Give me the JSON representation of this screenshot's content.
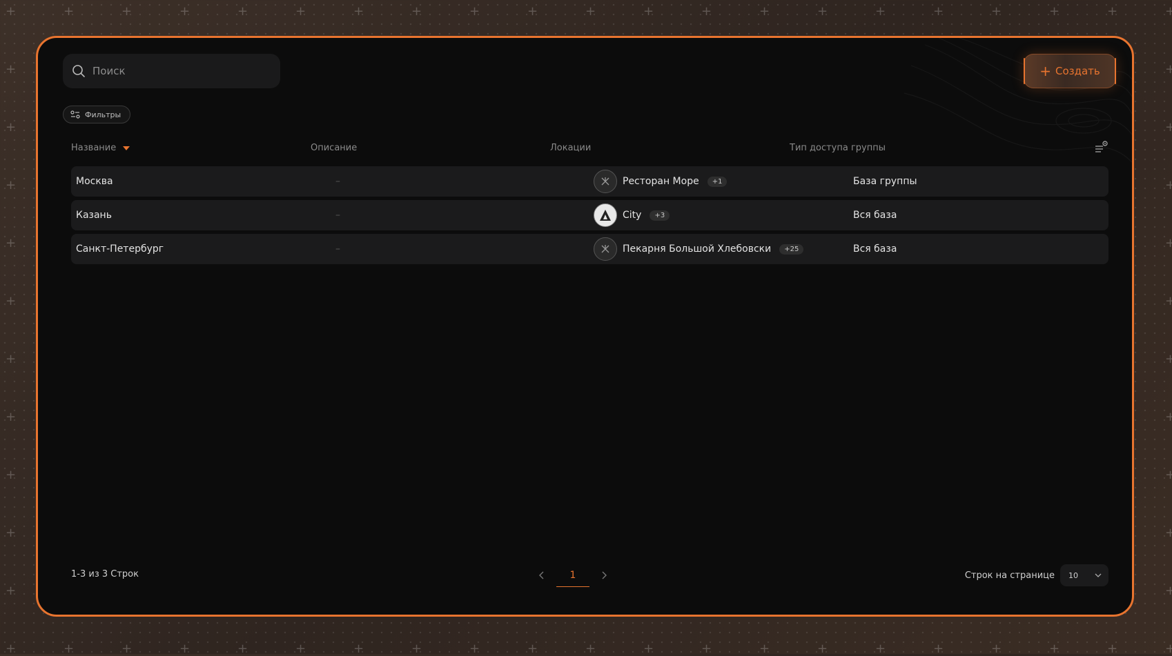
{
  "search": {
    "placeholder": "Поиск"
  },
  "toolbar": {
    "create_label": "Создать",
    "filters_label": "Фильтры"
  },
  "table": {
    "headers": {
      "name": "Название",
      "description": "Описание",
      "locations": "Локации",
      "access_type": "Тип доступа группы"
    },
    "sort": {
      "column": "name",
      "direction": "descending"
    },
    "rows": [
      {
        "name": "Москва",
        "description": "–",
        "location": "Ресторан Море",
        "location_extra": "+1",
        "access_type": "База группы",
        "avatar_icon": "restaurant-logo-icon"
      },
      {
        "name": "Казань",
        "description": "–",
        "location": "City",
        "location_extra": "+3",
        "access_type": "Вся база",
        "avatar_icon": "city-logo-icon"
      },
      {
        "name": "Санкт-Петербург",
        "description": "–",
        "location": "Пекарня Большой Хлебовски",
        "location_extra": "+25",
        "access_type": "Вся база",
        "avatar_icon": "bakery-logo-icon"
      }
    ]
  },
  "footer": {
    "count_text": "1-3 из 3 Строк",
    "current_page": "1",
    "per_page_label": "Строк на странице",
    "per_page_value": "10"
  },
  "colors": {
    "accent": "#e8742f",
    "panel": "#0c0c0c",
    "row": "#1b1b1c"
  }
}
